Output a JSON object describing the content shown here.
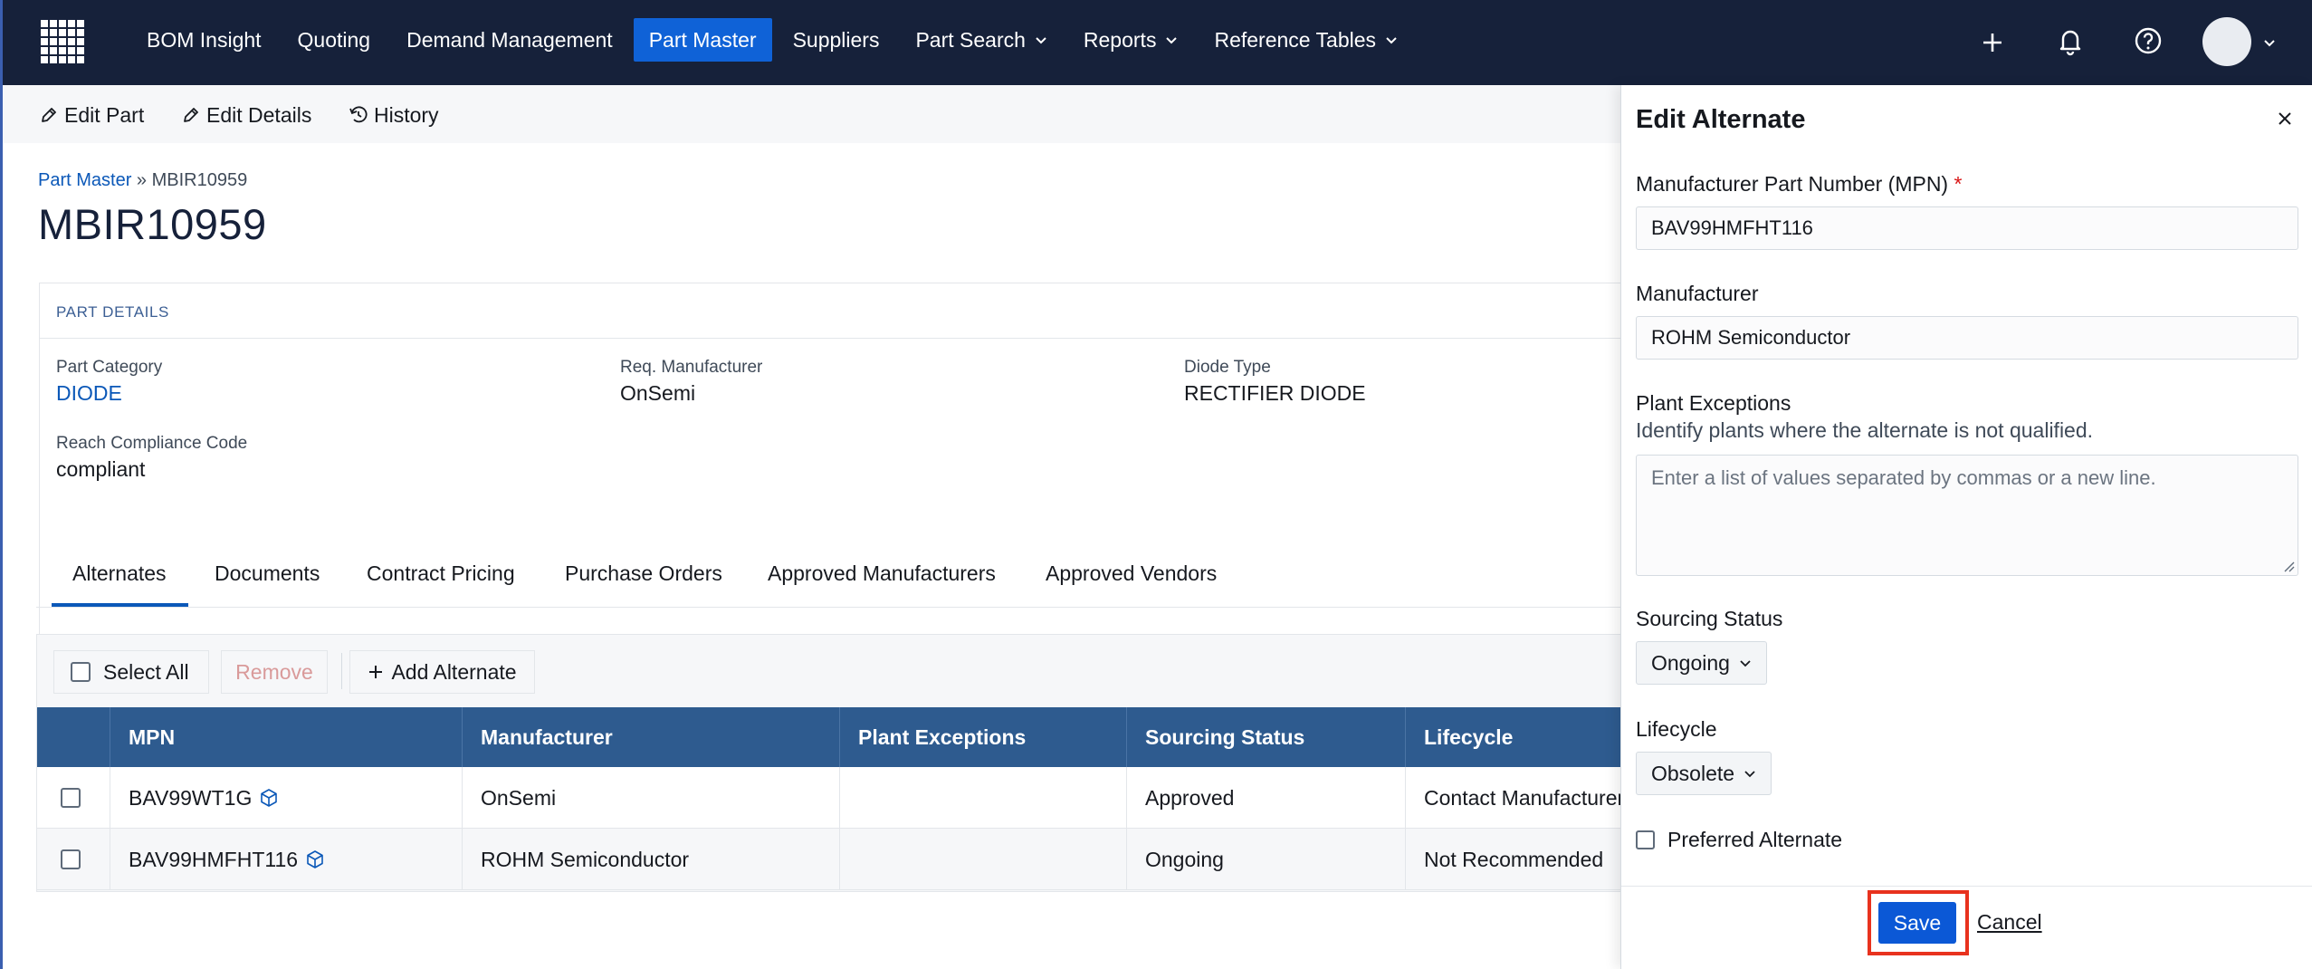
{
  "nav": {
    "items": [
      {
        "label": "BOM Insight",
        "dropdown": false,
        "active": false
      },
      {
        "label": "Quoting",
        "dropdown": false,
        "active": false
      },
      {
        "label": "Demand Management",
        "dropdown": false,
        "active": false
      },
      {
        "label": "Part Master",
        "dropdown": false,
        "active": true
      },
      {
        "label": "Suppliers",
        "dropdown": false,
        "active": false
      },
      {
        "label": "Part Search",
        "dropdown": true,
        "active": false
      },
      {
        "label": "Reports",
        "dropdown": true,
        "active": false
      },
      {
        "label": "Reference Tables",
        "dropdown": true,
        "active": false
      }
    ],
    "right_icons": [
      "plus-icon",
      "bell-icon",
      "help-icon",
      "user-avatar"
    ]
  },
  "toolbar": {
    "edit_part": "Edit Part",
    "edit_details": "Edit Details",
    "history": "History"
  },
  "breadcrumb": {
    "parent": "Part Master",
    "separator": " » ",
    "current": "MBIR10959"
  },
  "page_title": "MBIR10959",
  "part_details": {
    "header": "PART DETAILS",
    "fields": [
      {
        "label": "Part Category",
        "value": "DIODE",
        "is_link": true
      },
      {
        "label": "Req. Manufacturer",
        "value": "OnSemi",
        "is_link": false
      },
      {
        "label": "Diode Type",
        "value": "RECTIFIER DIODE",
        "is_link": false
      },
      {
        "label": "Reach Compliance Code",
        "value": "compliant",
        "is_link": false
      }
    ]
  },
  "tabs": [
    "Alternates",
    "Documents",
    "Contract Pricing",
    "Purchase Orders",
    "Approved Manufacturers",
    "Approved Vendors"
  ],
  "active_tab": "Alternates",
  "alternates_toolbar": {
    "select_all": "Select All",
    "remove": "Remove",
    "add_alternate": "Add Alternate"
  },
  "table": {
    "columns": [
      "MPN",
      "Manufacturer",
      "Plant Exceptions",
      "Sourcing Status",
      "Lifecycle"
    ],
    "rows": [
      {
        "mpn": "BAV99WT1G",
        "manufacturer": "OnSemi",
        "plant_exceptions": "",
        "sourcing_status": "Approved",
        "lifecycle": "Contact Manufacturer"
      },
      {
        "mpn": "BAV99HMFHT116",
        "manufacturer": "ROHM Semiconductor",
        "plant_exceptions": "",
        "sourcing_status": "Ongoing",
        "lifecycle": "Not Recommended"
      }
    ]
  },
  "panel": {
    "title": "Edit Alternate",
    "mpn_label": "Manufacturer Part Number (MPN)",
    "required_mark": "*",
    "mpn_value": "BAV99HMFHT116",
    "manufacturer_label": "Manufacturer",
    "manufacturer_value": "ROHM Semiconductor",
    "plant_exceptions_label": "Plant Exceptions",
    "plant_exceptions_desc": "Identify plants where the alternate is not qualified.",
    "plant_exceptions_placeholder": "Enter a list of values separated by commas or a new line.",
    "sourcing_status_label": "Sourcing Status",
    "sourcing_status_value": "Ongoing",
    "lifecycle_label": "Lifecycle",
    "lifecycle_value": "Obsolete",
    "preferred_label": "Preferred Alternate",
    "save": "Save",
    "cancel": "Cancel"
  },
  "colors": {
    "nav_bg": "#16213a",
    "accent": "#0f62d7",
    "table_header": "#2e5b8f",
    "highlight": "#e8321e"
  }
}
